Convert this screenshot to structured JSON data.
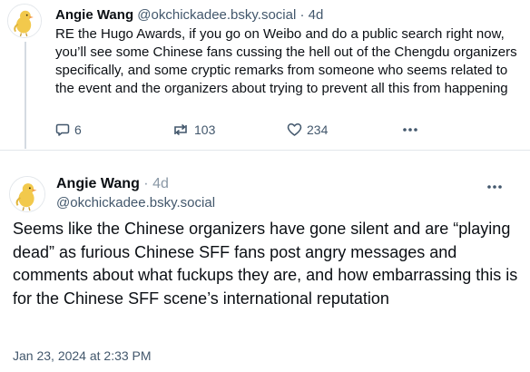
{
  "posts": [
    {
      "author": {
        "display_name": "Angie Wang",
        "handle": "@okchickadee.bsky.social"
      },
      "timestamp": "4d",
      "separator": "·",
      "text": "RE the Hugo Awards, if you go on Weibo and do a public search right now, you’ll see some Chinese fans cussing the hell out of the Chengdu organizers specifically, and some cryptic remarks from someone who seems related to the event and the organizers about trying to prevent all this from happening",
      "actions": {
        "replies": "6",
        "reposts": "103",
        "likes": "234",
        "reply_icon": "reply-bubble-icon",
        "repost_icon": "repost-arrows-icon",
        "like_icon": "heart-icon",
        "more_icon": "more-dots-icon"
      }
    },
    {
      "author": {
        "display_name": "Angie Wang",
        "handle": "@okchickadee.bsky.social"
      },
      "timestamp": "4d",
      "separator": "·",
      "text": "Seems like the Chinese organizers have gone silent and are “playing dead” as furious Chinese SFF fans post angry messages and comments about what fuckups they are, and how embarrassing this is for the Chinese SFF scene’s international reputation",
      "date_full": "Jan 23, 2024 at 2:33 PM",
      "more_icon": "more-dots-icon"
    }
  ],
  "colors": {
    "text_primary": "#0b0f14",
    "text_secondary": "#42576c",
    "thread_line": "#d4dbe2",
    "divider": "#e3e7eb",
    "avatar_chick": "#f2c94c",
    "avatar_beak": "#f2994a"
  }
}
